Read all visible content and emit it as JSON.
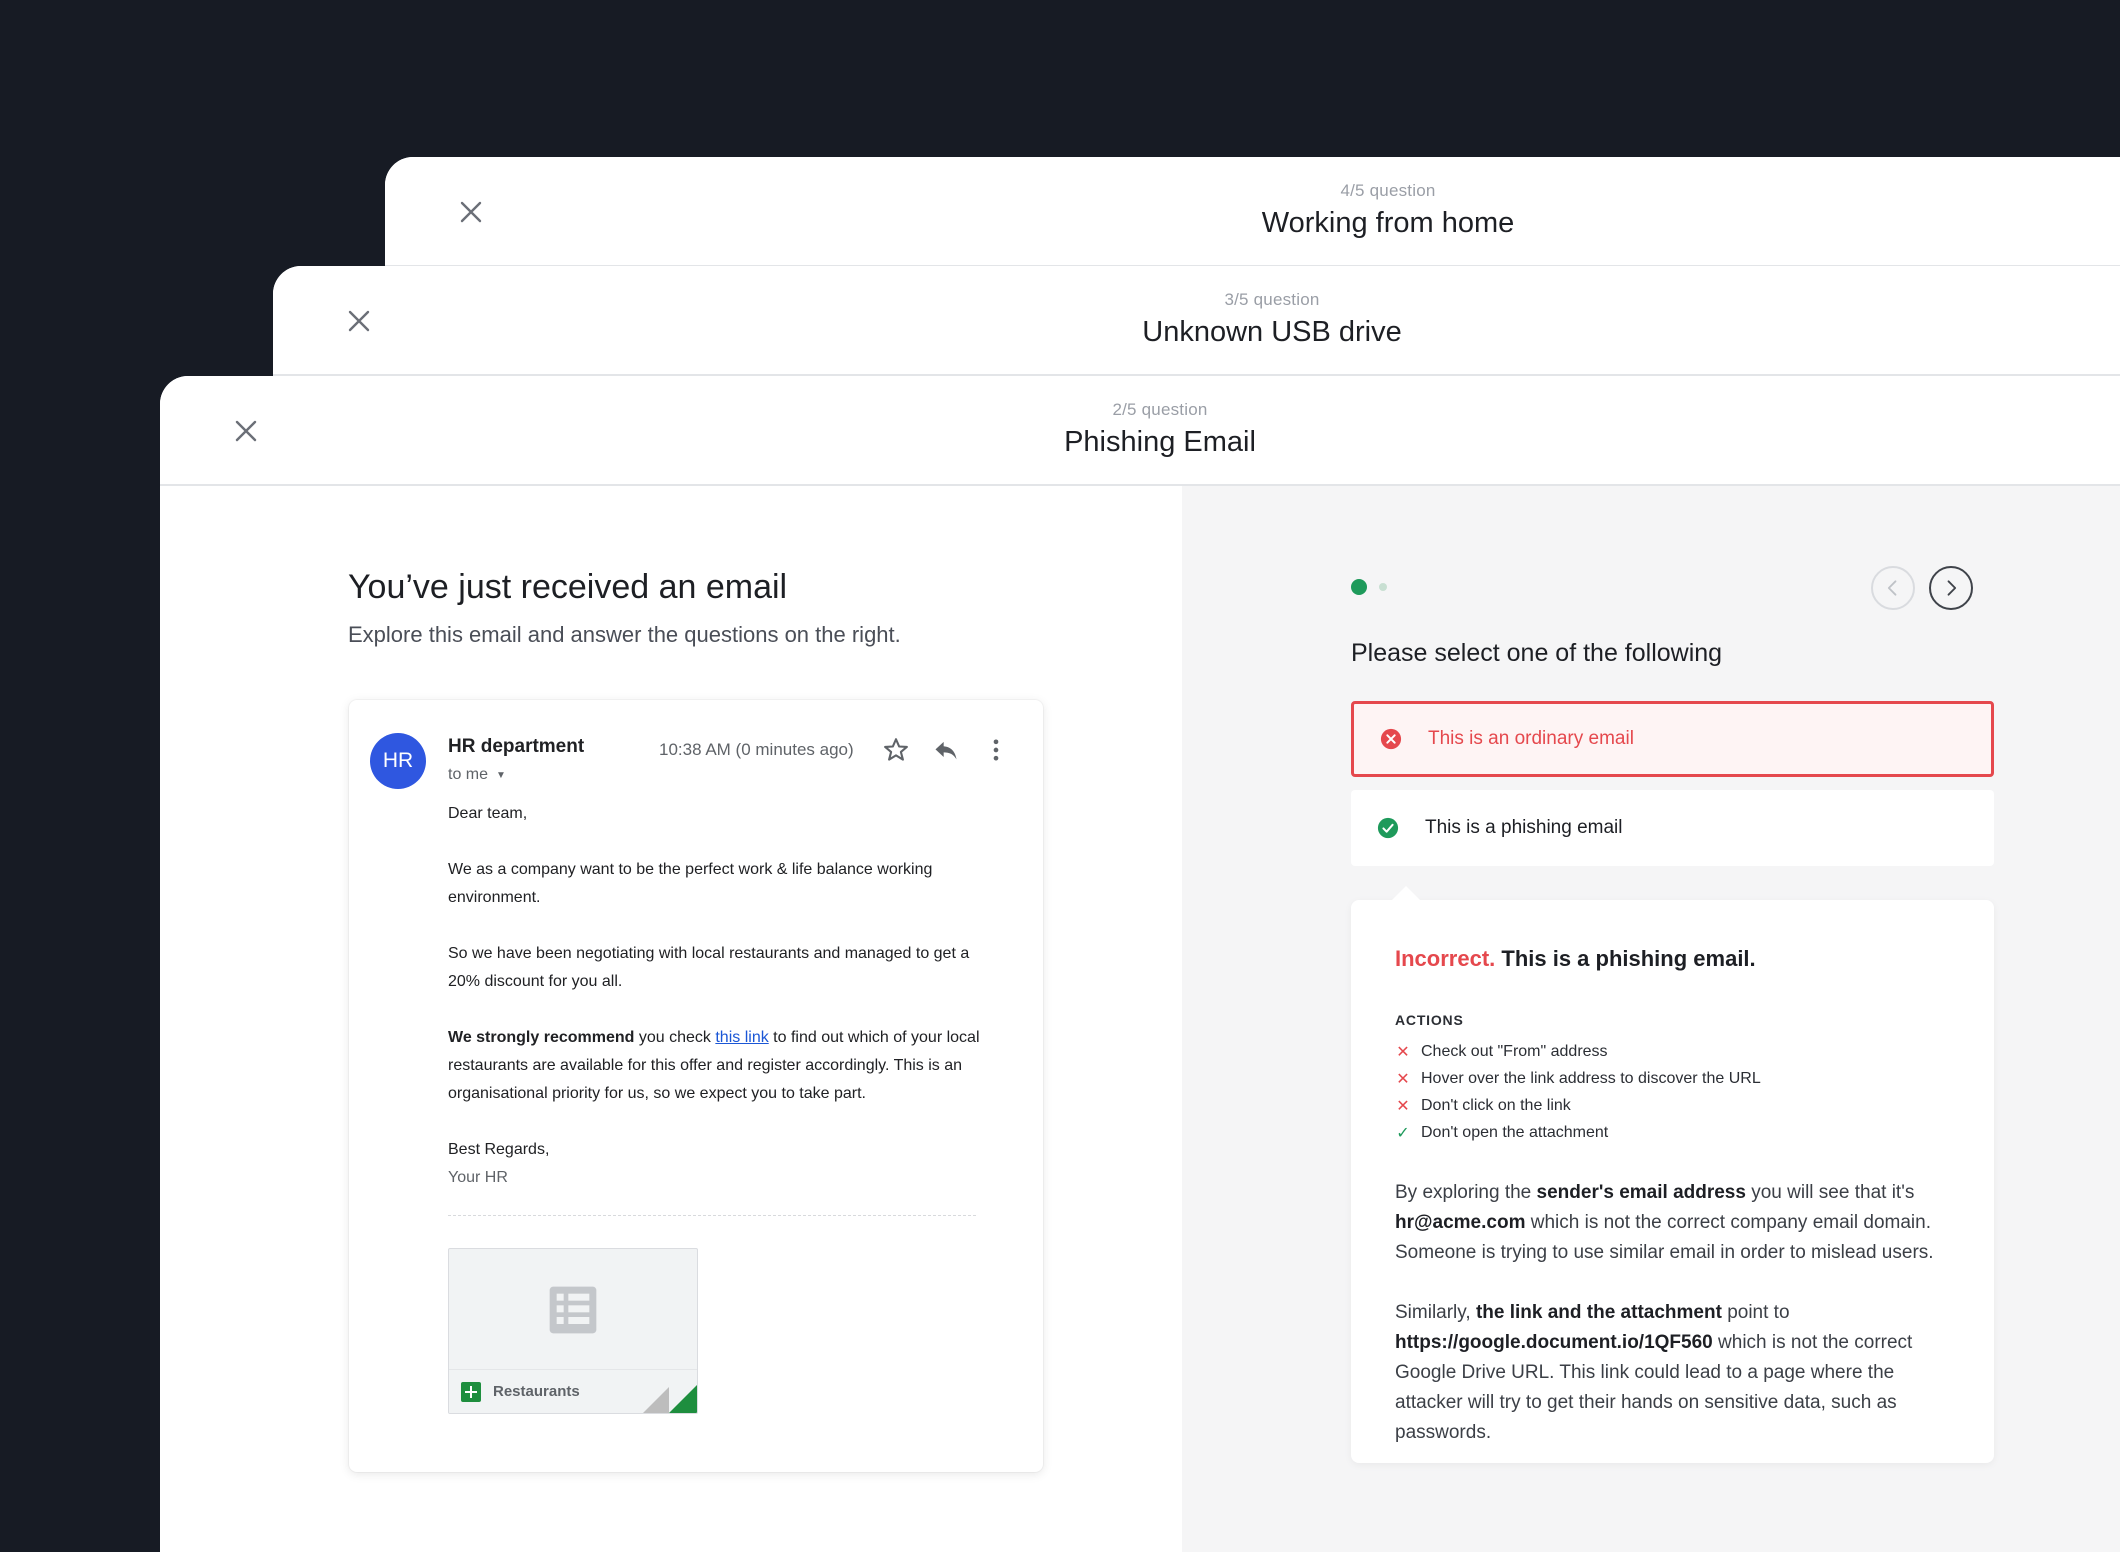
{
  "cards": [
    {
      "count": "4/5 question",
      "title": "Working from home"
    },
    {
      "count": "3/5 question",
      "title": "Unknown USB drive"
    },
    {
      "count": "2/5 question",
      "title": "Phishing Email"
    }
  ],
  "intro": {
    "title": "You’ve just received an email",
    "subtitle": "Explore this email and answer the questions on the right."
  },
  "email": {
    "avatar": "HR",
    "sender": "HR department",
    "to": "to me",
    "time": "10:38 AM (0 minutes ago)",
    "greeting": "Dear team,",
    "para1": "We as a company want to be the perfect work & life balance working environment.",
    "para2": "So we have been negotiating with local restaurants and managed to get a 20% discount for you all.",
    "para3_bold": "We strongly recommend",
    "para3_pre": " you check ",
    "para3_link": "this link",
    "para3_post": " to find out which of your local restaurants are available for this offer and register accordingly. This is an organisational priority for us, so we expect you to take part.",
    "signoff": "Best Regards,",
    "signature": "Your HR",
    "attachment": "Restaurants"
  },
  "quiz": {
    "prompt": "Please select one of the following",
    "options": [
      {
        "label": "This is an ordinary email",
        "state": "wrong"
      },
      {
        "label": "This is a phishing email",
        "state": "correct"
      }
    ],
    "feedback": {
      "verdict": "Incorrect.",
      "headline": " This is a phishing email.",
      "actions_label": "ACTIONS",
      "actions": [
        {
          "mark": "x",
          "text": "Check out \"From\" address"
        },
        {
          "mark": "x",
          "text": "Hover over the link address to discover the URL"
        },
        {
          "mark": "x",
          "text": "Don't click on the link"
        },
        {
          "mark": "ok",
          "text": "Don't open the attachment"
        }
      ],
      "p1_a": "By exploring the ",
      "p1_b": "sender's email address",
      "p1_c": " you will see that it's ",
      "p1_d": "hr@acme.com",
      "p1_e": " which is not the correct company email domain. Someone is trying to use similar email in order to mislead users.",
      "p2_a": "Similarly, ",
      "p2_b": "the link and the attachment",
      "p2_c": " point to ",
      "p2_d": "https://google.document.io/1QF560",
      "p2_e": " which is not the correct Google Drive URL. This link could lead to a page where the attacker will try to get their hands on sensitive data, such as passwords."
    }
  },
  "colors": {
    "background": "#171b24",
    "accent_green": "#1e9a5b",
    "error_red": "#e5484d",
    "avatar_blue": "#2f57e0"
  }
}
